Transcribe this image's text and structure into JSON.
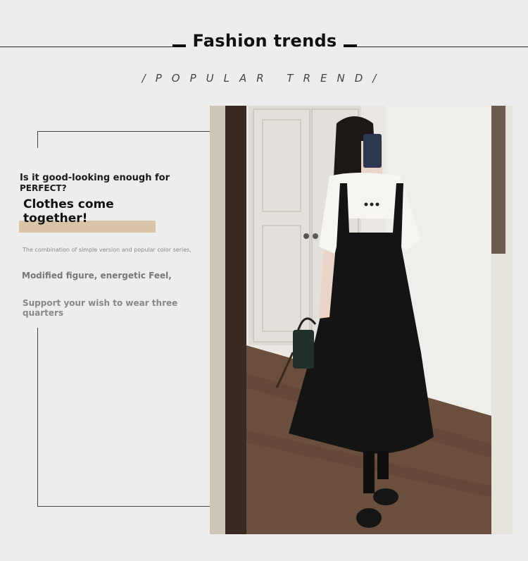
{
  "header": {
    "title": "Fashion trends",
    "subtitle": "/POPULAR TREND/"
  },
  "intro": {
    "question_line1": "Is it good-looking enough for",
    "question_line2": "PERFECT?",
    "headline_line1": "Clothes come",
    "headline_line2": "together!",
    "line1": "The combination of simple version and popular color series,",
    "line2": "Modified figure, energetic Feel,",
    "line3": "Support your wish to wear three quarters"
  },
  "colors": {
    "background": "#ededed",
    "highlight": "#d9c4a5",
    "dress": "#141414"
  },
  "photo": {
    "subject": "woman-mirror-selfie-black-pinafore-dress"
  }
}
